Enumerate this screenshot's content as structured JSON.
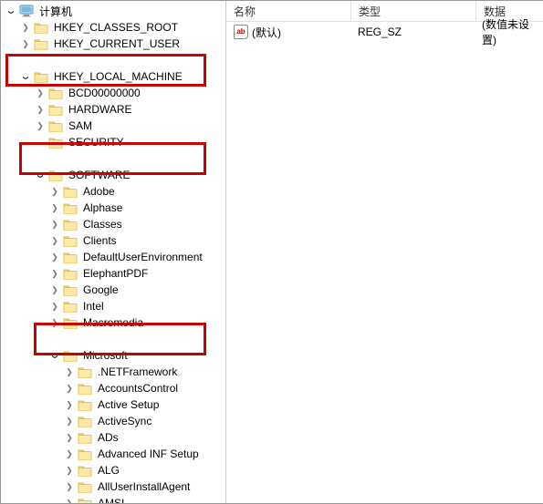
{
  "headers": {
    "name": "名称",
    "type": "类型",
    "data": "数据"
  },
  "value_row": {
    "name": "(默认)",
    "type": "REG_SZ",
    "data": "(数值未设置)"
  },
  "tree": [
    {
      "depth": 0,
      "toggle": "open",
      "icon": "computer",
      "label": "计算机"
    },
    {
      "depth": 1,
      "toggle": "closed",
      "icon": "folder",
      "label": "HKEY_CLASSES_ROOT"
    },
    {
      "depth": 1,
      "toggle": "closed",
      "icon": "folder",
      "label": "HKEY_CURRENT_USER"
    },
    {
      "depth": 0,
      "toggle": "none",
      "icon": "none",
      "label": ""
    },
    {
      "depth": 1,
      "toggle": "open",
      "icon": "folder",
      "label": "HKEY_LOCAL_MACHINE"
    },
    {
      "depth": 2,
      "toggle": "closed",
      "icon": "folder",
      "label": "BCD00000000"
    },
    {
      "depth": 2,
      "toggle": "closed",
      "icon": "folder",
      "label": "HARDWARE"
    },
    {
      "depth": 2,
      "toggle": "closed",
      "icon": "folder",
      "label": "SAM"
    },
    {
      "depth": 2,
      "toggle": "none",
      "icon": "folder",
      "label": "SECURITY"
    },
    {
      "depth": 0,
      "toggle": "none",
      "icon": "none",
      "label": ""
    },
    {
      "depth": 2,
      "toggle": "open",
      "icon": "folder",
      "label": "SOFTWARE"
    },
    {
      "depth": 3,
      "toggle": "closed",
      "icon": "folder",
      "label": "Adobe"
    },
    {
      "depth": 3,
      "toggle": "closed",
      "icon": "folder",
      "label": "Alphase"
    },
    {
      "depth": 3,
      "toggle": "closed",
      "icon": "folder",
      "label": "Classes"
    },
    {
      "depth": 3,
      "toggle": "closed",
      "icon": "folder",
      "label": "Clients"
    },
    {
      "depth": 3,
      "toggle": "closed",
      "icon": "folder",
      "label": "DefaultUserEnvironment"
    },
    {
      "depth": 3,
      "toggle": "closed",
      "icon": "folder",
      "label": "ElephantPDF"
    },
    {
      "depth": 3,
      "toggle": "closed",
      "icon": "folder",
      "label": "Google"
    },
    {
      "depth": 3,
      "toggle": "closed",
      "icon": "folder",
      "label": "Intel"
    },
    {
      "depth": 3,
      "toggle": "closed",
      "icon": "folder",
      "label": "Macromedia"
    },
    {
      "depth": 0,
      "toggle": "none",
      "icon": "none",
      "label": ""
    },
    {
      "depth": 3,
      "toggle": "open",
      "icon": "folder",
      "label": "Microsoft"
    },
    {
      "depth": 4,
      "toggle": "closed",
      "icon": "folder",
      "label": ".NETFramework"
    },
    {
      "depth": 4,
      "toggle": "closed",
      "icon": "folder",
      "label": "AccountsControl"
    },
    {
      "depth": 4,
      "toggle": "closed",
      "icon": "folder",
      "label": "Active Setup"
    },
    {
      "depth": 4,
      "toggle": "closed",
      "icon": "folder",
      "label": "ActiveSync"
    },
    {
      "depth": 4,
      "toggle": "closed",
      "icon": "folder",
      "label": "ADs"
    },
    {
      "depth": 4,
      "toggle": "closed",
      "icon": "folder",
      "label": "Advanced INF Setup"
    },
    {
      "depth": 4,
      "toggle": "closed",
      "icon": "folder",
      "label": "ALG"
    },
    {
      "depth": 4,
      "toggle": "closed",
      "icon": "folder",
      "label": "AllUserInstallAgent"
    },
    {
      "depth": 4,
      "toggle": "closed",
      "icon": "folder",
      "label": "AMSI"
    }
  ]
}
